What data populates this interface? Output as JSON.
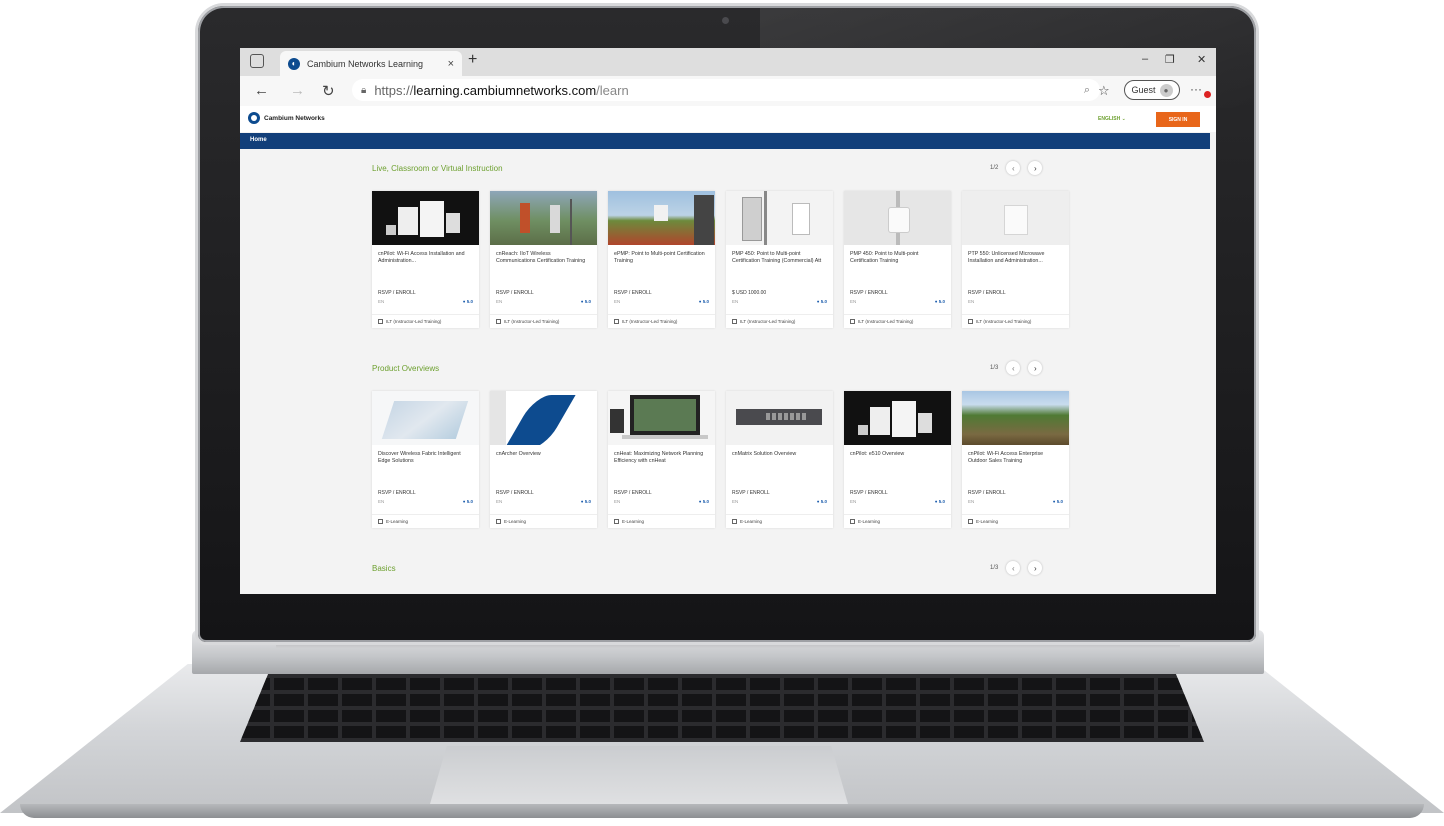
{
  "browser": {
    "tab_title": "Cambium Networks Learning",
    "tab_close": "×",
    "new_tab": "+",
    "url_protocol": "https://",
    "url_host": "learning.cambiumnetworks.com",
    "url_path": "/learn",
    "profile_label": "Guest",
    "window_controls": [
      "–",
      "❐",
      "✕"
    ]
  },
  "site": {
    "brand": "Cambium Networks",
    "language": "ENGLISH ⌄",
    "sign_in": "SIGN IN",
    "nav_home": "Home"
  },
  "sections": [
    {
      "title": "Live, Classroom or Virtual Instruction",
      "page": "1/2",
      "cards": [
        {
          "title": "cnPilot: Wi-Fi Access Installation and Administration...",
          "rsvp": "RSVP / ENROLL",
          "lang": "EN",
          "rating": "5.0",
          "type": "ILT (Instructor-Led Training)",
          "thumb": "dark-aps"
        },
        {
          "title": "cnReach: IIoT Wireless Communications Certification Training",
          "rsvp": "RSVP / ENROLL",
          "lang": "EN",
          "rating": "5.0",
          "type": "ILT (Instructor-Led Training)",
          "thumb": "field-workers"
        },
        {
          "title": "ePMP: Point to Multi-point Certification Training",
          "rsvp": "RSVP / ENROLL",
          "lang": "EN",
          "rating": "5.0",
          "type": "ILT (Instructor-Led Training)",
          "thumb": "field-radio"
        },
        {
          "title": "PMP 450: Point to Multi-point Certification Training (Commercial) Att",
          "rsvp": "$ USD 1000.00",
          "lang": "EN",
          "rating": "5.0",
          "type": "ILT (Instructor-Led Training)",
          "thumb": "pole-radios"
        },
        {
          "title": "PMP 450: Point to Multi-point Certification Training",
          "rsvp": "RSVP / ENROLL",
          "lang": "EN",
          "rating": "5.0",
          "type": "ILT (Instructor-Led Training)",
          "thumb": "white-radio"
        },
        {
          "title": "PTP 550: Unlicensed Microwave Installation and Administration...",
          "rsvp": "RSVP / ENROLL",
          "lang": "EN",
          "rating": "",
          "type": "ILT (Instructor-Led Training)",
          "thumb": "light-radio"
        }
      ]
    },
    {
      "title": "Product Overviews",
      "page": "1/3",
      "cards": [
        {
          "title": "Discover Wireless Fabric Intelligent Edge Solutions",
          "rsvp": "RSVP / ENROLL",
          "lang": "EN",
          "rating": "5.0",
          "type": "E-Learning",
          "thumb": "map"
        },
        {
          "title": "cnArcher Overview",
          "rsvp": "RSVP / ENROLL",
          "lang": "EN",
          "rating": "5.0",
          "type": "E-Learning",
          "thumb": "archer"
        },
        {
          "title": "cnHeat: Maximizing Network Planning Efficiency with cnHeat",
          "rsvp": "RSVP / ENROLL",
          "lang": "EN",
          "rating": "5.0",
          "type": "E-Learning",
          "thumb": "laptop"
        },
        {
          "title": "cnMatrix Solution Overview",
          "rsvp": "RSVP / ENROLL",
          "lang": "EN",
          "rating": "5.0",
          "type": "E-Learning",
          "thumb": "switch"
        },
        {
          "title": "cnPilot: e510 Overview",
          "rsvp": "RSVP / ENROLL",
          "lang": "EN",
          "rating": "5.0",
          "type": "E-Learning",
          "thumb": "dark-aps"
        },
        {
          "title": "cnPilot: Wi-Fi Access Enterprise Outdoor Sales Training",
          "rsvp": "RSVP / ENROLL",
          "lang": "EN",
          "rating": "5.0",
          "type": "E-Learning",
          "thumb": "landscape"
        }
      ]
    },
    {
      "title": "Basics",
      "page": "1/3",
      "cards": []
    }
  ],
  "colors": {
    "accent_green": "#6da02f",
    "nav_blue": "#123f7a",
    "signin_orange": "#e8661a",
    "rating_blue": "#1f5fae"
  }
}
